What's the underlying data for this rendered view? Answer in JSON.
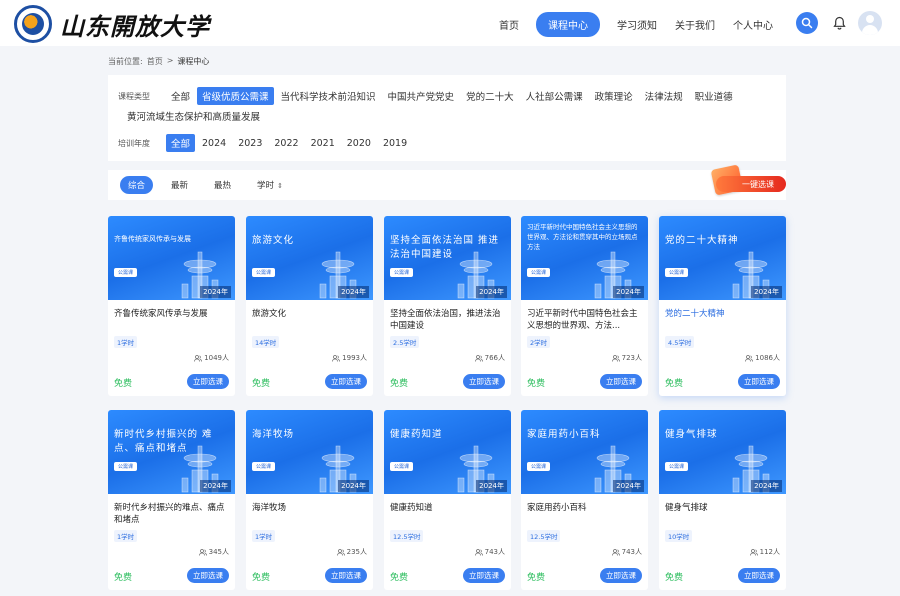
{
  "header": {
    "logo_text": "山东開放大学",
    "nav": [
      "首页",
      "课程中心",
      "学习须知",
      "关于我们",
      "个人中心"
    ],
    "nav_active_index": 1,
    "icons": {
      "search": "search-icon",
      "notification": "bell-icon",
      "user": "avatar"
    }
  },
  "breadcrumb": {
    "prefix": "当前位置:",
    "home": "首页",
    "sep": ">",
    "current": "课程中心"
  },
  "filters": {
    "type_label": "课程类型",
    "types": [
      "全部",
      "省级优质公需课",
      "当代科学技术前沿知识",
      "中国共产党党史",
      "党的二十大",
      "人社部公需课",
      "政策理论",
      "法律法规",
      "职业道德"
    ],
    "types_row2": [
      "黄河流域生态保护和高质量发展"
    ],
    "type_active": "省级优质公需课",
    "year_label": "培训年度",
    "years": [
      "全部",
      "2024",
      "2023",
      "2022",
      "2021",
      "2020",
      "2019"
    ],
    "year_active": "全部"
  },
  "sort": {
    "options": [
      "综合",
      "最新",
      "最热",
      "学时"
    ],
    "active": "综合",
    "hours_arrow": "⇕"
  },
  "one_click": "一键选课",
  "colors": {
    "primary": "#3a7ef0",
    "free": "#2bbd5d",
    "accent_red": "#e5281e"
  },
  "courses": [
    {
      "banner": "齐鲁传统家风传承与发展",
      "tag": "公需课",
      "year": "2024年",
      "title": "齐鲁传统家风传承与发展",
      "hours": "1学时",
      "people": "1049人",
      "price": "免费",
      "action": "立即选课"
    },
    {
      "banner": "旅游文化",
      "tag": "公需课",
      "year": "2024年",
      "title": "旅游文化",
      "hours": "14学时",
      "people": "1993人",
      "price": "免费",
      "action": "立即选课"
    },
    {
      "banner": "坚持全面依法治国 推进法治中国建设",
      "tag": "公需课",
      "year": "2024年",
      "title": "坚持全面依法治国，推进法治中国建设",
      "hours": "2.5学时",
      "people": "766人",
      "price": "免费",
      "action": "立即选课"
    },
    {
      "banner": "习近平新时代中国特色社会主义思想的世界观、方法论和贯穿其中的立场观点方法",
      "tag": "公需课",
      "year": "2024年",
      "title": "习近平新时代中国特色社会主义思想的世界观、方法...",
      "hours": "2学时",
      "people": "723人",
      "price": "免费",
      "action": "立即选课"
    },
    {
      "banner": "党的二十大精神",
      "tag": "公需课",
      "year": "2024年",
      "title": "党的二十大精神",
      "hours": "4.5学时",
      "people": "1086人",
      "price": "免费",
      "action": "立即选课"
    },
    {
      "banner": "新时代乡村振兴的 难点、痛点和堵点",
      "tag": "公需课",
      "year": "2024年",
      "title": "新时代乡村振兴的难点、痛点和堵点",
      "hours": "1学时",
      "people": "345人",
      "price": "免费",
      "action": "立即选课"
    },
    {
      "banner": "海洋牧场",
      "tag": "公需课",
      "year": "2024年",
      "title": "海洋牧场",
      "hours": "1学时",
      "people": "235人",
      "price": "免费",
      "action": "立即选课"
    },
    {
      "banner": "健康药知道",
      "tag": "公需课",
      "year": "2024年",
      "title": "健康药知道",
      "hours": "12.5学时",
      "people": "743人",
      "price": "免费",
      "action": "立即选课"
    },
    {
      "banner": "家庭用药小百科",
      "tag": "公需课",
      "year": "2024年",
      "title": "家庭用药小百科",
      "hours": "12.5学时",
      "people": "743人",
      "price": "免费",
      "action": "立即选课"
    },
    {
      "banner": "健身气排球",
      "tag": "公需课",
      "year": "2024年",
      "title": "健身气排球",
      "hours": "10学时",
      "people": "112人",
      "price": "免费",
      "action": "立即选课"
    }
  ]
}
